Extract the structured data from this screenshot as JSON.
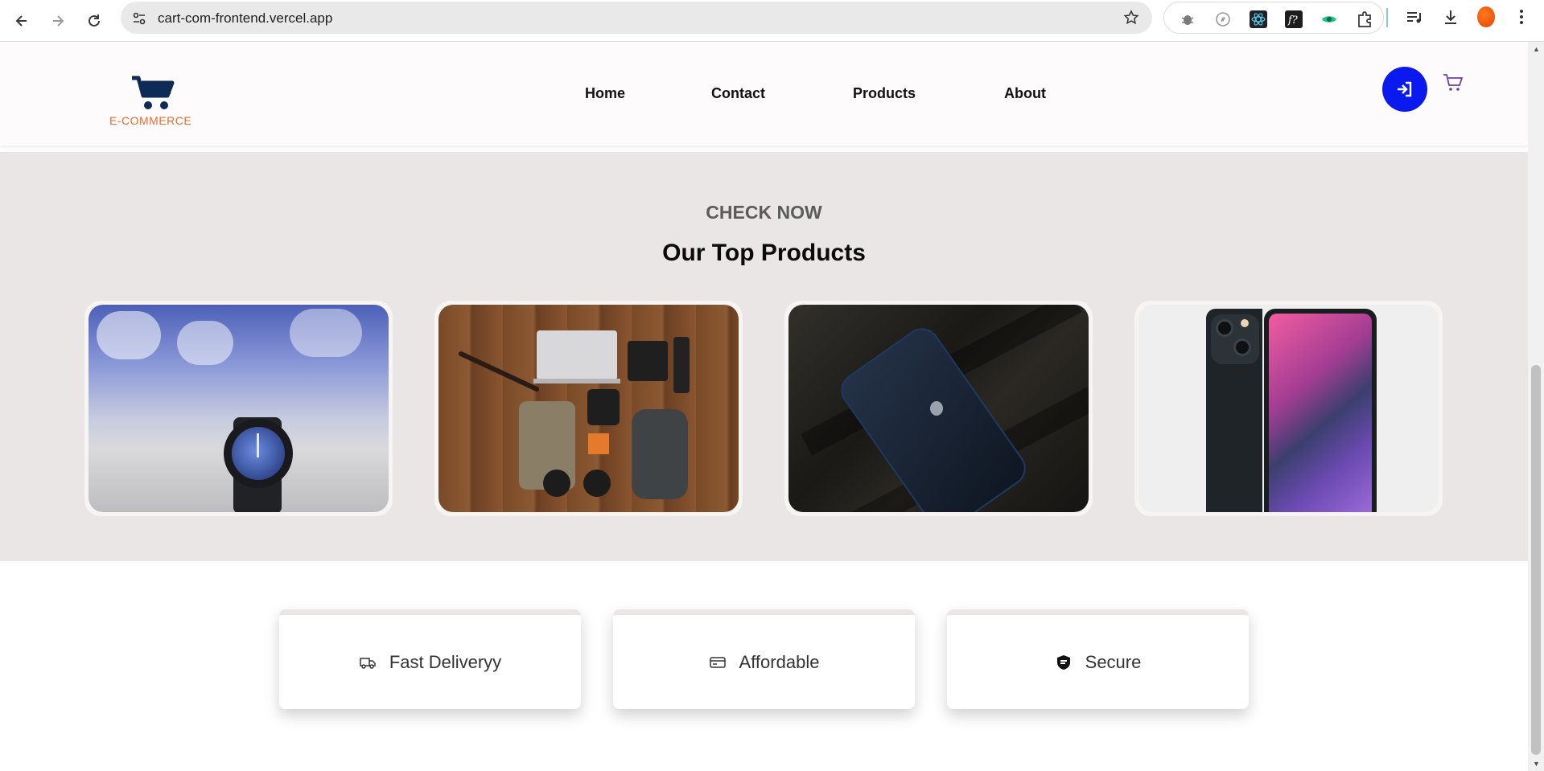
{
  "browser": {
    "url": "cart-com-frontend.vercel.app",
    "icons": [
      "back-icon",
      "forward-icon",
      "reload-icon",
      "site-info-icon",
      "bookmark-star-icon",
      "bug-extension-icon",
      "compass-extension-icon",
      "react-devtools-icon",
      "function-extension-icon",
      "eye-extension-icon",
      "puzzle-extensions-icon",
      "media-queue-icon",
      "download-icon",
      "profile-avatar",
      "menu-kebab-icon"
    ]
  },
  "header": {
    "logo_text": "E-COMMERCE",
    "nav": [
      "Home",
      "Contact",
      "Products",
      "About"
    ],
    "icons": [
      "login-icon",
      "cart-icon"
    ],
    "colors": {
      "login_bg": "#0a1aee",
      "logo_accent": "#ec6b2d",
      "logo_cart": "#0f2a56"
    }
  },
  "products_section": {
    "subtitle": "CHECK NOW",
    "title": "Our Top Products",
    "products": [
      {
        "image": "smartwatch-photo"
      },
      {
        "image": "camera-gear-flatlay-photo"
      },
      {
        "image": "iphone-dark-photo"
      },
      {
        "image": "iphone-13-photo"
      }
    ]
  },
  "features": [
    {
      "label": "Fast Deliveryy",
      "icon": "truck-icon"
    },
    {
      "label": "Affordable",
      "icon": "credit-card-icon"
    },
    {
      "label": "Secure",
      "icon": "shield-icon"
    }
  ]
}
